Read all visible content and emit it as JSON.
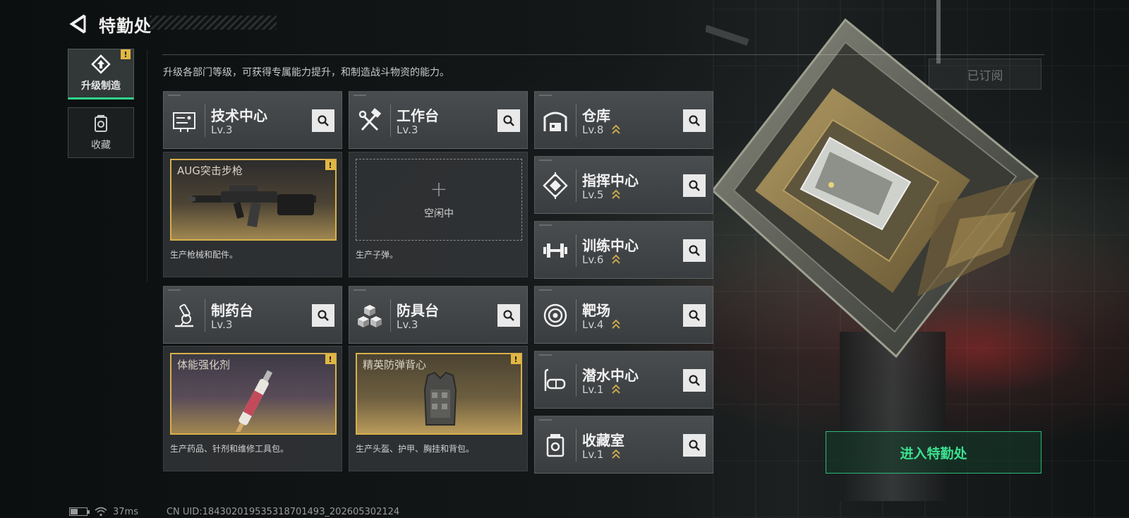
{
  "header": {
    "title": "特勤处"
  },
  "side_tabs": [
    {
      "label": "升级制造",
      "active": true,
      "icon": "upgrade-icon",
      "alert": "!"
    },
    {
      "label": "收藏",
      "active": false,
      "icon": "collection-icon"
    }
  ],
  "description": "升级各部门等级，可获得专属能力提升，和制造战斗物资的能力。",
  "subscribed_label": "已订阅",
  "facilities": {
    "tech_center": {
      "name": "技术中心",
      "level": "Lv.3",
      "icon": "circuit-icon"
    },
    "workbench": {
      "name": "工作台",
      "level": "Lv.3",
      "icon": "tools-icon"
    },
    "warehouse": {
      "name": "仓库",
      "level": "Lv.8",
      "icon": "warehouse-icon"
    },
    "command_center": {
      "name": "指挥中心",
      "level": "Lv.5",
      "icon": "command-icon"
    },
    "training_center": {
      "name": "训练中心",
      "level": "Lv.6",
      "icon": "dumbbell-icon"
    },
    "pharmacy": {
      "name": "制药台",
      "level": "Lv.3",
      "icon": "microscope-icon"
    },
    "armor_bench": {
      "name": "防具台",
      "level": "Lv.3",
      "icon": "cubes-icon"
    },
    "shooting_range": {
      "name": "靶场",
      "level": "Lv.4",
      "icon": "target-icon"
    },
    "diving_center": {
      "name": "潜水中心",
      "level": "Lv.1",
      "icon": "diving-mask-icon"
    },
    "collection_room": {
      "name": "收藏室",
      "level": "Lv.1",
      "icon": "collection-icon"
    }
  },
  "productions": {
    "tech_center": {
      "item": "AUG突击步枪",
      "desc": "生产枪械和配件。",
      "alert": "!"
    },
    "workbench": {
      "item": "空闲中",
      "plus": "+",
      "desc": "生产子弹。"
    },
    "pharmacy": {
      "item": "体能强化剂",
      "desc": "生产药品、针剂和维修工具包。",
      "alert": "!"
    },
    "armor_bench": {
      "item": "精英防弹背心",
      "desc": "生产头盔、护甲、胸挂和背包。",
      "alert": "!"
    }
  },
  "enter_button": "进入特勤处",
  "status_bar": {
    "ping": "37ms",
    "uid": "CN UID:18430201953531870149З_202605302124"
  },
  "colors": {
    "accent_green": "#2ed58a",
    "alert_yellow": "#e1b743",
    "product_border": "#d7b04a"
  }
}
